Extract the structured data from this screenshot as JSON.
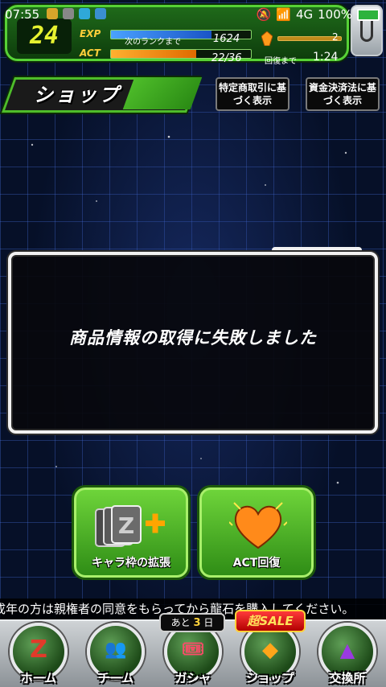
{
  "status_bar": {
    "time": "07:55",
    "network": "4G",
    "battery_percent": "100%"
  },
  "header": {
    "rank": "24",
    "exp_label": "EXP",
    "exp_caption": "次のランクまで",
    "exp_value": "1624",
    "exp_fill_fraction": 0.72,
    "act_label": "ACT",
    "act_value": "22/36",
    "act_fill_fraction": 0.61,
    "stone_value": "2",
    "recover_label": "回復まで",
    "recover_time": "1:24"
  },
  "title": {
    "label": "ショップ"
  },
  "legal_buttons": [
    {
      "label": "特定商取引に基づく表示"
    },
    {
      "label": "資金決済法に基づく表示"
    }
  ],
  "panel": {
    "message": "商品情報の取得に失敗しました"
  },
  "actions": [
    {
      "label": "キャラ枠の拡張",
      "icon": "character-slot-expand-icon"
    },
    {
      "label": "ACT回復",
      "icon": "heart-icon"
    }
  ],
  "marquee": {
    "text": "成年の方は親権者の同意をもらってから龍石を購入してください。"
  },
  "gacha_badge": {
    "prefix": "あと",
    "days": "3",
    "suffix": "日"
  },
  "sale_badge": {
    "label": "SALE",
    "prefix": "超"
  },
  "nav": [
    {
      "label": "ホーム",
      "icon": "z-logo-icon"
    },
    {
      "label": "チーム",
      "icon": "team-icon"
    },
    {
      "label": "ガシャ",
      "icon": "gacha-icon"
    },
    {
      "label": "ショップ",
      "icon": "dragon-stone-icon"
    },
    {
      "label": "交換所",
      "icon": "exchange-icon"
    }
  ],
  "colors": {
    "accent_green": "#4ebd2a",
    "exp_blue": "#4aa2ff",
    "act_orange": "#ffb030"
  }
}
